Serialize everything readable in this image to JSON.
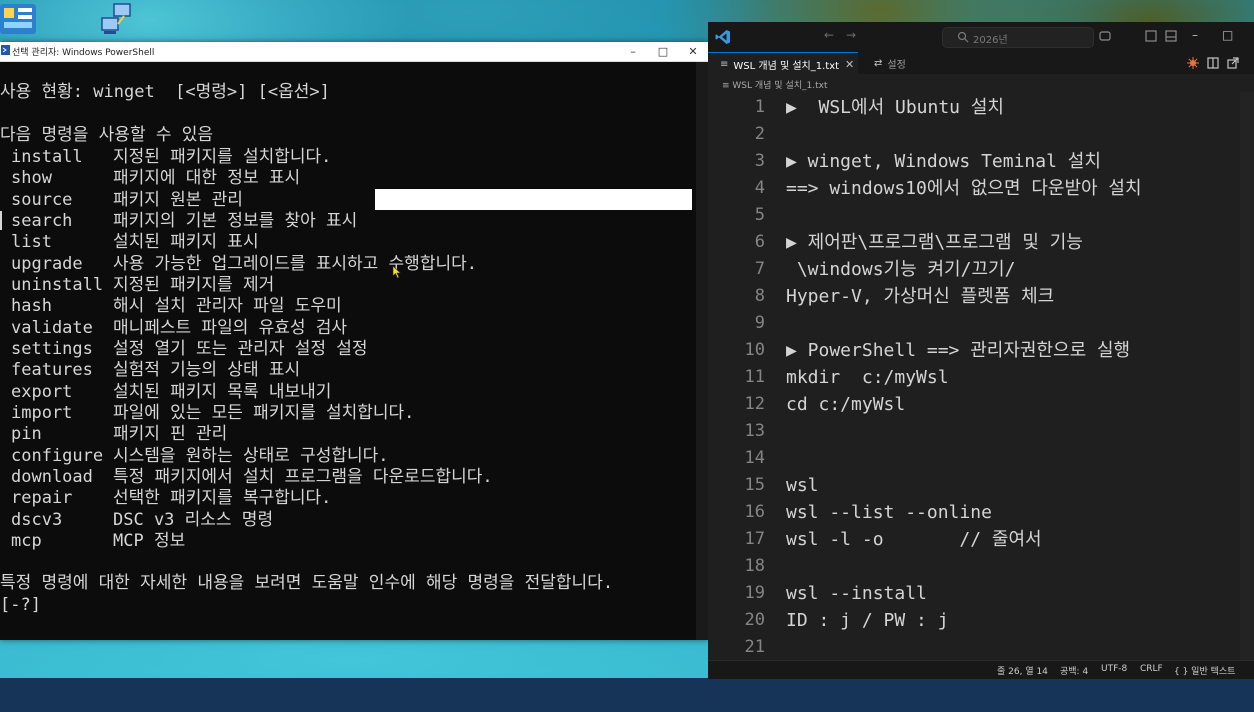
{
  "powershell": {
    "title": "선택 관리자: Windows PowerShell",
    "minimize": "–",
    "maximize": "□",
    "close": "✕",
    "usage_line": "사용 현황: winget  [<명령>] [<옵션>]",
    "commands_heading": "다음 명령을 사용할 수 있음",
    "commands": [
      {
        "cmd": "install",
        "desc": "지정된 패키지를 설치합니다."
      },
      {
        "cmd": "show",
        "desc": "패키지에 대한 정보 표시"
      },
      {
        "cmd": "source",
        "desc": "패키지 원본 관리"
      },
      {
        "cmd": "search",
        "desc": "패키지의 기본 정보를 찾아 표시"
      },
      {
        "cmd": "list",
        "desc": "설치된 패키지 표시"
      },
      {
        "cmd": "upgrade",
        "desc": "사용 가능한 업그레이드를 표시하고 수행합니다."
      },
      {
        "cmd": "uninstall",
        "desc": "지정된 패키지를 제거"
      },
      {
        "cmd": "hash",
        "desc": "해시 설치 관리자 파일 도우미"
      },
      {
        "cmd": "validate",
        "desc": "매니페스트 파일의 유효성 검사"
      },
      {
        "cmd": "settings",
        "desc": "설정 열기 또는 관리자 설정 설정"
      },
      {
        "cmd": "features",
        "desc": "실험적 기능의 상태 표시"
      },
      {
        "cmd": "export",
        "desc": "설치된 패키지 목록 내보내기"
      },
      {
        "cmd": "import",
        "desc": "파일에 있는 모든 패키지를 설치합니다."
      },
      {
        "cmd": "pin",
        "desc": "패키지 핀 관리"
      },
      {
        "cmd": "configure",
        "desc": "시스템을 원하는 상태로 구성합니다."
      },
      {
        "cmd": "download",
        "desc": "특정 패키지에서 설치 프로그램을 다운로드합니다."
      },
      {
        "cmd": "repair",
        "desc": "선택한 패키지를 복구합니다."
      },
      {
        "cmd": "dscv3",
        "desc": "DSC v3 리소스 명령"
      },
      {
        "cmd": "mcp",
        "desc": "MCP 정보"
      }
    ],
    "help_line": "특정 명령에 대한 자세한 내용을 보려면 도움말 인수에 해당 명령을 전달합니다.",
    "help_flag": "[-?]"
  },
  "vscode": {
    "search_placeholder": "2026년",
    "back_arrow": "←",
    "forward_arrow": "→",
    "minimize": "–",
    "maximize": "□",
    "tabs": [
      {
        "label": "WSL 개념 및 설치_1.txt",
        "icon": "≡",
        "close": "✕"
      },
      {
        "label": "설정",
        "icon": "⇄"
      }
    ],
    "breadcrumb": "≡  WSL 개념 및 설치_1.txt",
    "lines": [
      {
        "num": "1",
        "text": "▶  WSL에서 Ubuntu 설치"
      },
      {
        "num": "2",
        "text": ""
      },
      {
        "num": "3",
        "text": "▶ winget, Windows Teminal 설치"
      },
      {
        "num": "4",
        "text": "==> windows10에서 없으면 다운받아 설치"
      },
      {
        "num": "5",
        "text": ""
      },
      {
        "num": "6",
        "text": "▶ 제어판\\프로그램\\프로그램 및 기능"
      },
      {
        "num": "7",
        "text": " \\windows기능 켜기/끄기/"
      },
      {
        "num": "8",
        "text": "Hyper-V, 가상머신 플렛폼 체크"
      },
      {
        "num": "9",
        "text": ""
      },
      {
        "num": "10",
        "text": "▶ PowerShell ==> 관리자권한으로 실행"
      },
      {
        "num": "11",
        "text": "mkdir  c:/myWsl"
      },
      {
        "num": "12",
        "text": "cd c:/myWsl"
      },
      {
        "num": "13",
        "text": ""
      },
      {
        "num": "14",
        "text": ""
      },
      {
        "num": "15",
        "text": "wsl"
      },
      {
        "num": "16",
        "text": "wsl --list --online"
      },
      {
        "num": "17",
        "text": "wsl -l -o       // 줄여서"
      },
      {
        "num": "18",
        "text": ""
      },
      {
        "num": "19",
        "text": "wsl --install"
      },
      {
        "num": "20",
        "text": "ID : j / PW : j"
      },
      {
        "num": "21",
        "text": ""
      }
    ],
    "status": {
      "position": "줄 26, 열 14",
      "spaces": "공백: 4",
      "encoding": "UTF-8",
      "eol": "CRLF",
      "language": "{ } 일반 텍스트"
    }
  }
}
